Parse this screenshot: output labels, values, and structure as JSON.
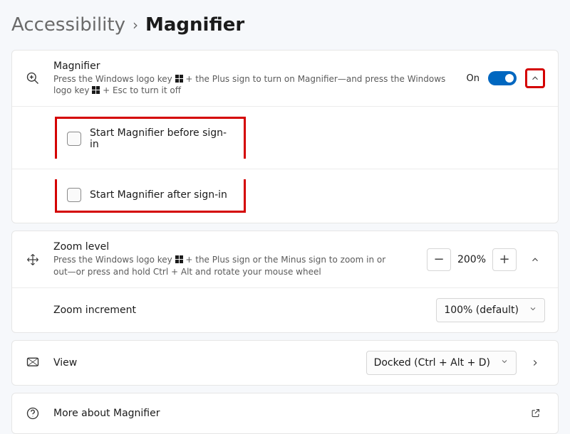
{
  "breadcrumb": {
    "parent": "Accessibility",
    "current": "Magnifier"
  },
  "magnifier": {
    "title": "Magnifier",
    "desc_a": "Press the Windows logo key ",
    "desc_b": " + the Plus sign to turn on Magnifier—and press the Windows logo key ",
    "desc_c": " + Esc to turn it off",
    "state_label": "On",
    "sub": {
      "before": "Start Magnifier before sign-in",
      "after": "Start Magnifier after sign-in"
    }
  },
  "zoom_level": {
    "title": "Zoom level",
    "desc_a": "Press the Windows logo key ",
    "desc_b": " + the Plus sign or the Minus sign to zoom in or out—or press and hold Ctrl + Alt and rotate your mouse wheel",
    "value": "200%"
  },
  "zoom_increment": {
    "title": "Zoom increment",
    "value": "100% (default)"
  },
  "view": {
    "title": "View",
    "value": "Docked (Ctrl + Alt + D)"
  },
  "more": {
    "title": "More about Magnifier"
  }
}
